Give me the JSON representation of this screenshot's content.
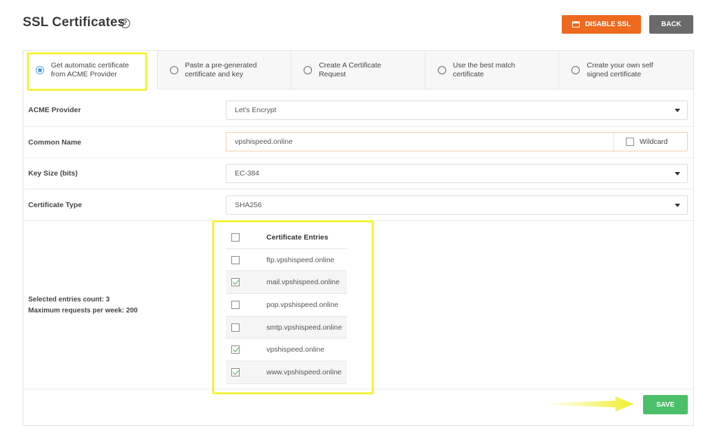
{
  "header": {
    "title": "SSL Certificates",
    "disable_ssl_label": "DISABLE SSL",
    "back_label": "BACK"
  },
  "tabs": [
    {
      "label": "Get automatic certificate\nfrom ACME Provider",
      "selected": true
    },
    {
      "label": "Paste a pre-generated\ncertificate and key",
      "selected": false
    },
    {
      "label": "Create A Certificate\nRequest",
      "selected": false
    },
    {
      "label": "Use the best match\ncertificate",
      "selected": false
    },
    {
      "label": "Create your own self\nsigned certificate",
      "selected": false
    }
  ],
  "form": {
    "acme_provider": {
      "label": "ACME Provider",
      "value": "Let's Encrypt"
    },
    "common_name": {
      "label": "Common Name",
      "value": "vpshispeed.online",
      "wildcard_label": "Wildcard",
      "wildcard_checked": false
    },
    "key_size": {
      "label": "Key Size (bits)",
      "value": "EC-384"
    },
    "certificate_type": {
      "label": "Certificate Type",
      "value": "SHA256"
    }
  },
  "entries": {
    "header": "Certificate Entries",
    "items": [
      {
        "name": "ftp.vpshispeed.online",
        "checked": false
      },
      {
        "name": "mail.vpshispeed.online",
        "checked": true
      },
      {
        "name": "pop.vpshispeed.online",
        "checked": false
      },
      {
        "name": "smtp.vpshispeed.online",
        "checked": false
      },
      {
        "name": "vpshispeed.online",
        "checked": true
      },
      {
        "name": "www.vpshispeed.online",
        "checked": true
      }
    ],
    "selected_count_text": "Selected entries count: 3",
    "max_requests_text": "Maximum requests per week: 200"
  },
  "save_label": "SAVE",
  "colors": {
    "disable_ssl": "#ee6a1e",
    "back": "#6a6a6a",
    "save": "#4cbf6a",
    "highlight": "#f4f23b",
    "radio_selected": "#4b9de0"
  }
}
